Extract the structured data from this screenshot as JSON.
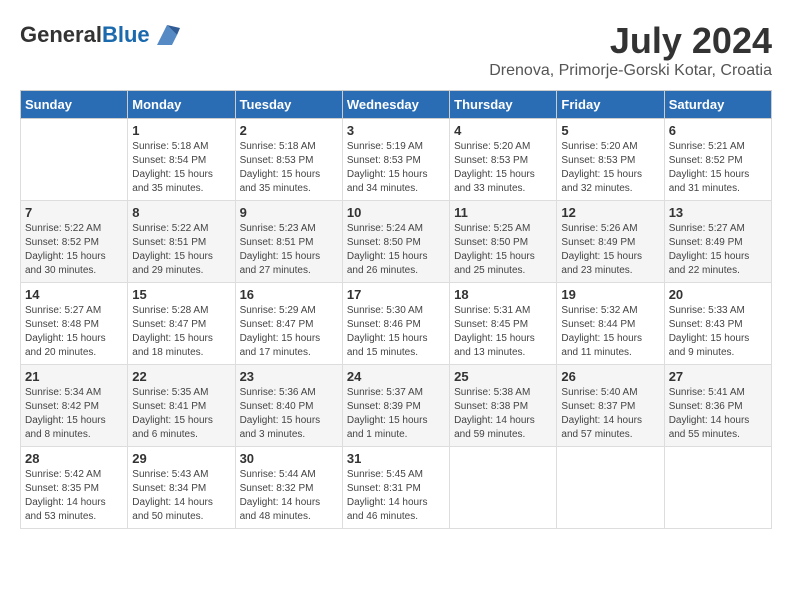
{
  "header": {
    "logo_general": "General",
    "logo_blue": "Blue",
    "month_year": "July 2024",
    "location": "Drenova, Primorje-Gorski Kotar, Croatia"
  },
  "calendar": {
    "days_of_week": [
      "Sunday",
      "Monday",
      "Tuesday",
      "Wednesday",
      "Thursday",
      "Friday",
      "Saturday"
    ],
    "weeks": [
      [
        {
          "day": "",
          "sunrise": "",
          "sunset": "",
          "daylight": ""
        },
        {
          "day": "1",
          "sunrise": "Sunrise: 5:18 AM",
          "sunset": "Sunset: 8:54 PM",
          "daylight": "Daylight: 15 hours and 35 minutes."
        },
        {
          "day": "2",
          "sunrise": "Sunrise: 5:18 AM",
          "sunset": "Sunset: 8:53 PM",
          "daylight": "Daylight: 15 hours and 35 minutes."
        },
        {
          "day": "3",
          "sunrise": "Sunrise: 5:19 AM",
          "sunset": "Sunset: 8:53 PM",
          "daylight": "Daylight: 15 hours and 34 minutes."
        },
        {
          "day": "4",
          "sunrise": "Sunrise: 5:20 AM",
          "sunset": "Sunset: 8:53 PM",
          "daylight": "Daylight: 15 hours and 33 minutes."
        },
        {
          "day": "5",
          "sunrise": "Sunrise: 5:20 AM",
          "sunset": "Sunset: 8:53 PM",
          "daylight": "Daylight: 15 hours and 32 minutes."
        },
        {
          "day": "6",
          "sunrise": "Sunrise: 5:21 AM",
          "sunset": "Sunset: 8:52 PM",
          "daylight": "Daylight: 15 hours and 31 minutes."
        }
      ],
      [
        {
          "day": "7",
          "sunrise": "Sunrise: 5:22 AM",
          "sunset": "Sunset: 8:52 PM",
          "daylight": "Daylight: 15 hours and 30 minutes."
        },
        {
          "day": "8",
          "sunrise": "Sunrise: 5:22 AM",
          "sunset": "Sunset: 8:51 PM",
          "daylight": "Daylight: 15 hours and 29 minutes."
        },
        {
          "day": "9",
          "sunrise": "Sunrise: 5:23 AM",
          "sunset": "Sunset: 8:51 PM",
          "daylight": "Daylight: 15 hours and 27 minutes."
        },
        {
          "day": "10",
          "sunrise": "Sunrise: 5:24 AM",
          "sunset": "Sunset: 8:50 PM",
          "daylight": "Daylight: 15 hours and 26 minutes."
        },
        {
          "day": "11",
          "sunrise": "Sunrise: 5:25 AM",
          "sunset": "Sunset: 8:50 PM",
          "daylight": "Daylight: 15 hours and 25 minutes."
        },
        {
          "day": "12",
          "sunrise": "Sunrise: 5:26 AM",
          "sunset": "Sunset: 8:49 PM",
          "daylight": "Daylight: 15 hours and 23 minutes."
        },
        {
          "day": "13",
          "sunrise": "Sunrise: 5:27 AM",
          "sunset": "Sunset: 8:49 PM",
          "daylight": "Daylight: 15 hours and 22 minutes."
        }
      ],
      [
        {
          "day": "14",
          "sunrise": "Sunrise: 5:27 AM",
          "sunset": "Sunset: 8:48 PM",
          "daylight": "Daylight: 15 hours and 20 minutes."
        },
        {
          "day": "15",
          "sunrise": "Sunrise: 5:28 AM",
          "sunset": "Sunset: 8:47 PM",
          "daylight": "Daylight: 15 hours and 18 minutes."
        },
        {
          "day": "16",
          "sunrise": "Sunrise: 5:29 AM",
          "sunset": "Sunset: 8:47 PM",
          "daylight": "Daylight: 15 hours and 17 minutes."
        },
        {
          "day": "17",
          "sunrise": "Sunrise: 5:30 AM",
          "sunset": "Sunset: 8:46 PM",
          "daylight": "Daylight: 15 hours and 15 minutes."
        },
        {
          "day": "18",
          "sunrise": "Sunrise: 5:31 AM",
          "sunset": "Sunset: 8:45 PM",
          "daylight": "Daylight: 15 hours and 13 minutes."
        },
        {
          "day": "19",
          "sunrise": "Sunrise: 5:32 AM",
          "sunset": "Sunset: 8:44 PM",
          "daylight": "Daylight: 15 hours and 11 minutes."
        },
        {
          "day": "20",
          "sunrise": "Sunrise: 5:33 AM",
          "sunset": "Sunset: 8:43 PM",
          "daylight": "Daylight: 15 hours and 9 minutes."
        }
      ],
      [
        {
          "day": "21",
          "sunrise": "Sunrise: 5:34 AM",
          "sunset": "Sunset: 8:42 PM",
          "daylight": "Daylight: 15 hours and 8 minutes."
        },
        {
          "day": "22",
          "sunrise": "Sunrise: 5:35 AM",
          "sunset": "Sunset: 8:41 PM",
          "daylight": "Daylight: 15 hours and 6 minutes."
        },
        {
          "day": "23",
          "sunrise": "Sunrise: 5:36 AM",
          "sunset": "Sunset: 8:40 PM",
          "daylight": "Daylight: 15 hours and 3 minutes."
        },
        {
          "day": "24",
          "sunrise": "Sunrise: 5:37 AM",
          "sunset": "Sunset: 8:39 PM",
          "daylight": "Daylight: 15 hours and 1 minute."
        },
        {
          "day": "25",
          "sunrise": "Sunrise: 5:38 AM",
          "sunset": "Sunset: 8:38 PM",
          "daylight": "Daylight: 14 hours and 59 minutes."
        },
        {
          "day": "26",
          "sunrise": "Sunrise: 5:40 AM",
          "sunset": "Sunset: 8:37 PM",
          "daylight": "Daylight: 14 hours and 57 minutes."
        },
        {
          "day": "27",
          "sunrise": "Sunrise: 5:41 AM",
          "sunset": "Sunset: 8:36 PM",
          "daylight": "Daylight: 14 hours and 55 minutes."
        }
      ],
      [
        {
          "day": "28",
          "sunrise": "Sunrise: 5:42 AM",
          "sunset": "Sunset: 8:35 PM",
          "daylight": "Daylight: 14 hours and 53 minutes."
        },
        {
          "day": "29",
          "sunrise": "Sunrise: 5:43 AM",
          "sunset": "Sunset: 8:34 PM",
          "daylight": "Daylight: 14 hours and 50 minutes."
        },
        {
          "day": "30",
          "sunrise": "Sunrise: 5:44 AM",
          "sunset": "Sunset: 8:32 PM",
          "daylight": "Daylight: 14 hours and 48 minutes."
        },
        {
          "day": "31",
          "sunrise": "Sunrise: 5:45 AM",
          "sunset": "Sunset: 8:31 PM",
          "daylight": "Daylight: 14 hours and 46 minutes."
        },
        {
          "day": "",
          "sunrise": "",
          "sunset": "",
          "daylight": ""
        },
        {
          "day": "",
          "sunrise": "",
          "sunset": "",
          "daylight": ""
        },
        {
          "day": "",
          "sunrise": "",
          "sunset": "",
          "daylight": ""
        }
      ]
    ]
  }
}
